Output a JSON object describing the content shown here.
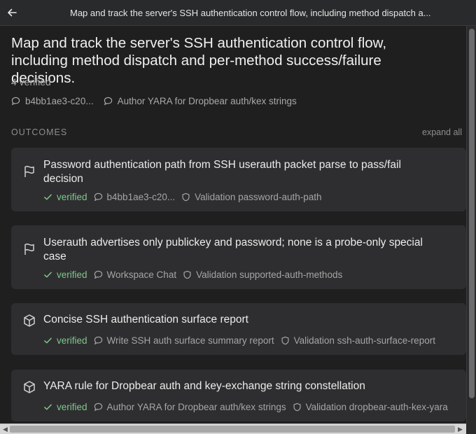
{
  "header": {
    "title": "Map and track the server's SSH authentication control flow, including method dispatch a..."
  },
  "main": {
    "title": "Map and track the server's SSH authentication control flow, including method dispatch and per-method success/failure decisions.",
    "verified_count": "4 verified",
    "meta": [
      {
        "icon": "chat-bubble-icon",
        "label": "b4bb1ae3-c20..."
      },
      {
        "icon": "chat-bubble-icon",
        "label": "Author YARA for Dropbear auth/kex strings"
      }
    ]
  },
  "outcomes": {
    "label": "OUTCOMES",
    "expand_label": "expand all",
    "items": [
      {
        "icon": "flag-icon",
        "title": "Password authentication path from SSH userauth packet parse to pass/fail decision",
        "status": "verified",
        "chat": "b4bb1ae3-c20...",
        "validation": "Validation password-auth-path"
      },
      {
        "icon": "flag-icon",
        "title": "Userauth advertises only publickey and password; none is a probe-only special case",
        "status": "verified",
        "chat": "Workspace Chat",
        "validation": "Validation supported-auth-methods"
      },
      {
        "icon": "cube-icon",
        "title": "Concise SSH authentication surface report",
        "status": "verified",
        "chat": "Write SSH auth surface summary report",
        "validation": "Validation ssh-auth-surface-report"
      },
      {
        "icon": "cube-icon",
        "title": "YARA rule for Dropbear auth and key-exchange string constellation",
        "status": "verified",
        "chat": "Author YARA for Dropbear auth/kex strings",
        "validation": "Validation dropbear-auth-kex-yara"
      }
    ]
  },
  "colors": {
    "background": "#1f1f20",
    "card": "#2e2e30",
    "verified": "#7fc98a"
  }
}
